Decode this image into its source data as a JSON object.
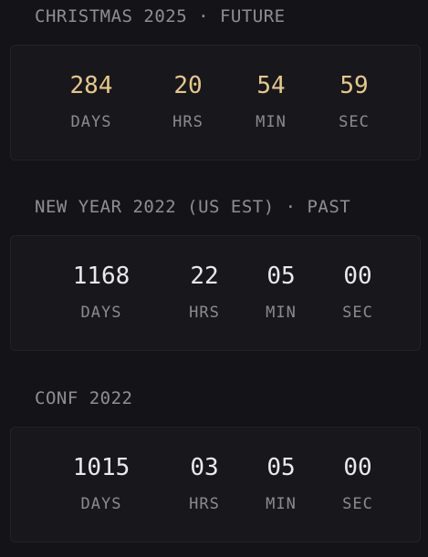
{
  "countdowns": [
    {
      "title": "CHRISTMAS 2025 · FUTURE",
      "state": "future",
      "units": [
        {
          "value": "284",
          "label": "DAYS"
        },
        {
          "value": "20",
          "label": "HRS"
        },
        {
          "value": "54",
          "label": "MIN"
        },
        {
          "value": "59",
          "label": "SEC"
        }
      ]
    },
    {
      "title": "NEW YEAR 2022 (US EST) · PAST",
      "state": "past",
      "units": [
        {
          "value": "1168",
          "label": "DAYS"
        },
        {
          "value": "22",
          "label": "HRS"
        },
        {
          "value": "05",
          "label": "MIN"
        },
        {
          "value": "00",
          "label": "SEC"
        }
      ]
    },
    {
      "title": "CONF 2022",
      "state": "past",
      "units": [
        {
          "value": "1015",
          "label": "DAYS"
        },
        {
          "value": "03",
          "label": "HRS"
        },
        {
          "value": "05",
          "label": "MIN"
        },
        {
          "value": "00",
          "label": "SEC"
        }
      ]
    }
  ],
  "colors": {
    "background": "#141418",
    "card": "#18181c",
    "future_value": "#e6c889",
    "past_value": "#e9e9ee",
    "label": "#8a8a91"
  }
}
